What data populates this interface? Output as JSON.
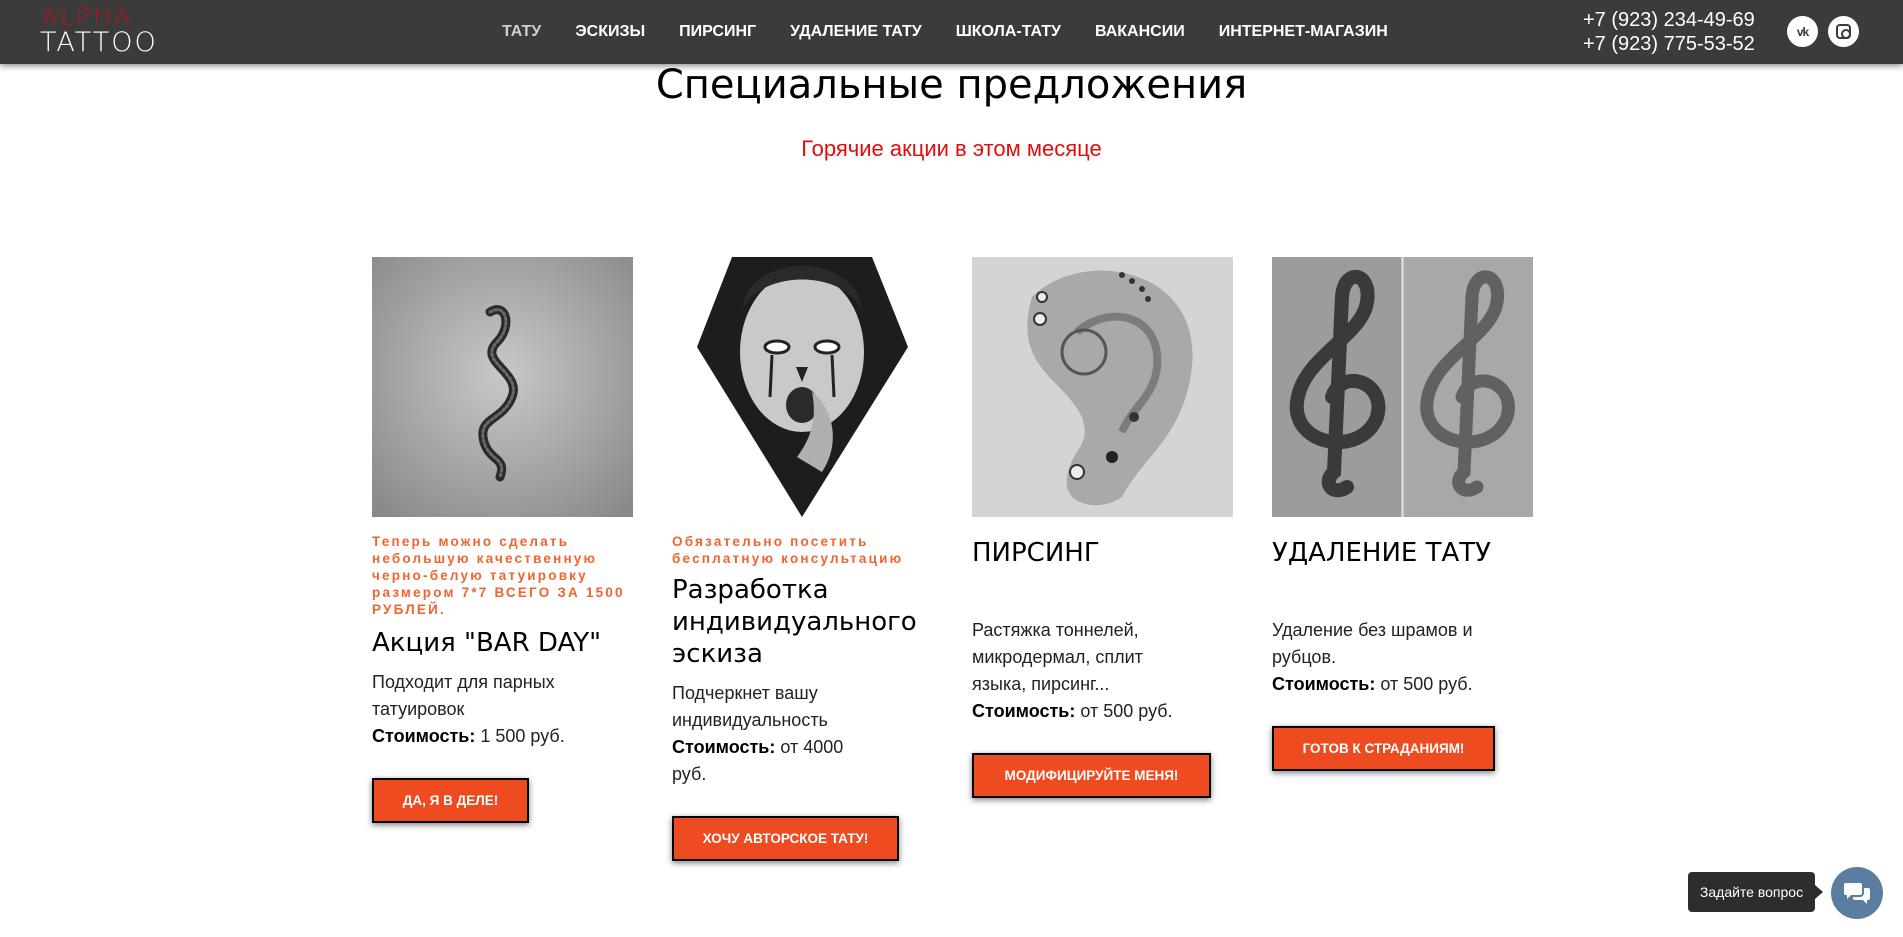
{
  "header": {
    "logo_top": "ALPHA",
    "logo_bottom": "TATTOO",
    "nav": [
      {
        "label": "ТАТУ",
        "active": true
      },
      {
        "label": "ЭСКИЗЫ",
        "active": false
      },
      {
        "label": "ПИРСИНГ",
        "active": false
      },
      {
        "label": "УДАЛЕНИЕ ТАТУ",
        "active": false
      },
      {
        "label": "ШКОЛА-ТАТУ",
        "active": false
      },
      {
        "label": "ВАКАНСИИ",
        "active": false
      },
      {
        "label": "ИНТЕРНЕТ-МАГАЗИН",
        "active": false
      }
    ],
    "phone1": "+7 (923) 234-49-69",
    "phone2": "+7 (923) 775-53-52",
    "social": {
      "vk_icon": "vk-icon",
      "instagram_icon": "instagram-icon"
    }
  },
  "section": {
    "title": "Специальные предложения",
    "subtitle": "Горячие акции в этом месяце"
  },
  "cards": [
    {
      "image": "snake-tattoo-photo",
      "tagline": "Теперь можно сделать небольшую качественную черно-белую татуировку размером 7*7 ВСЕГО ЗА 1500 РУБЛЕЙ.",
      "title": "Акция \"BAR DAY\"",
      "desc": "Подходит для парных татуировок",
      "price_label": "Стоимость:",
      "price": " 1 500 руб.",
      "button": "ДА, Я В ДЕЛЕ!"
    },
    {
      "image": "woman-face-sketch-photo",
      "tagline": "Обязательно посетить бесплатную консультацию",
      "title": "Разработка индивидуального эскиза",
      "desc": "Подчеркнет вашу индивидуальность",
      "price_label": "Стоимость:",
      "price": " от 4000 руб.",
      "button": "ХОЧУ АВТОРСКОЕ ТАТУ!"
    },
    {
      "image": "ear-piercing-photo",
      "tagline": "",
      "title": "ПИРСИНГ",
      "desc": "Растяжка тоннелей, микродермал, сплит языка, пирсинг...",
      "price_label": "Стоимость:",
      "price": " от 500 руб.",
      "button": "МОДИФИЦИРУЙТЕ МЕНЯ!"
    },
    {
      "image": "treble-clef-removal-photo",
      "tagline": "",
      "title": "УДАЛЕНИЕ ТАТУ",
      "desc": "Удаление без шрамов и рубцов.",
      "price_label": "Стоимость:",
      "price": " от 500 руб.",
      "button": "ГОТОВ К СТРАДАНИЯМ!"
    }
  ],
  "chat": {
    "label": "Задайте вопрос",
    "icon": "chat-bubbles-icon"
  },
  "colors": {
    "header_bg": "#3b3b3b",
    "logo_red": "#a8161b",
    "subtitle_red": "#e30b0b",
    "tagline_orange": "#f0642f",
    "button_orange": "#ee4b20",
    "chat_blue": "#5b7ea0"
  }
}
